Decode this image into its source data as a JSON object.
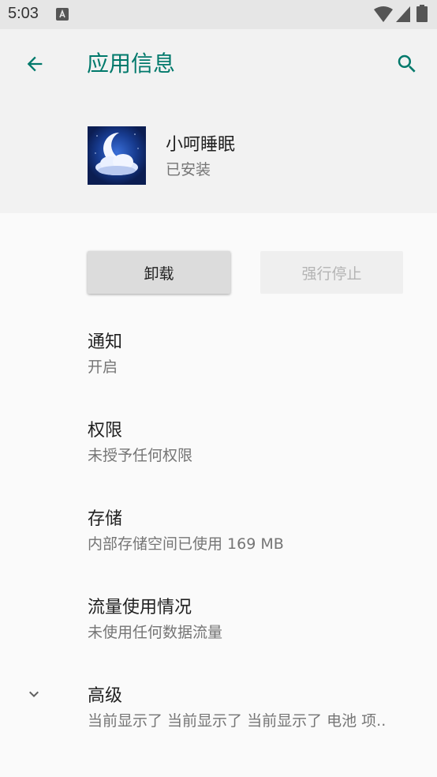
{
  "status_bar": {
    "time": "5:03",
    "icons": [
      "notification-a-icon",
      "wifi-icon",
      "signal-icon",
      "battery-icon"
    ]
  },
  "toolbar": {
    "title": "应用信息",
    "back_icon": "arrow-back-icon",
    "search_icon": "search-icon",
    "accent_color": "#00796b"
  },
  "app": {
    "name": "小呵睡眠",
    "status": "已安装",
    "icon": "moon-cloud-icon"
  },
  "actions": {
    "uninstall": "卸载",
    "force_stop": "强行停止"
  },
  "settings": [
    {
      "title": "通知",
      "summary": "开启"
    },
    {
      "title": "权限",
      "summary": "未授予任何权限"
    },
    {
      "title": "存储",
      "summary": "内部存储空间已使用 169 MB"
    },
    {
      "title": "流量使用情况",
      "summary": "未使用任何数据流量"
    },
    {
      "title": "高级",
      "summary": "当前显示了 当前显示了 当前显示了 电池 项..",
      "icon": "chevron-down-icon"
    }
  ]
}
